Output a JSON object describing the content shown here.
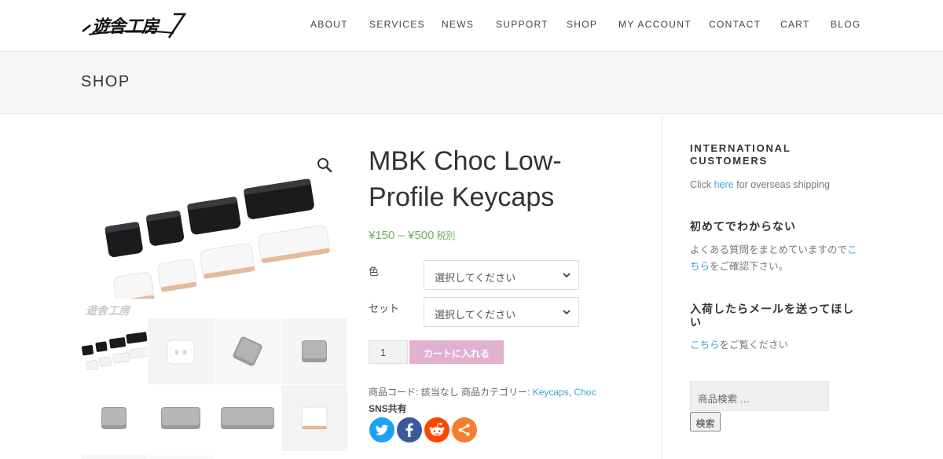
{
  "site": {
    "logo_text": "遊舎工房"
  },
  "nav": {
    "items": [
      {
        "label": "ABOUT"
      },
      {
        "label": "SERVICES"
      },
      {
        "label": "NEWS"
      },
      {
        "label": "SUPPORT"
      },
      {
        "label": "SHOP"
      },
      {
        "label": "MY ACCOUNT"
      },
      {
        "label": "CONTACT"
      },
      {
        "label": "CART"
      },
      {
        "label": "BLOG"
      }
    ]
  },
  "page": {
    "title": "SHOP"
  },
  "product": {
    "title": "MBK Choc Low-Profile Keycaps",
    "price": "¥150 – ¥500",
    "price_suffix": "税別",
    "variations": [
      {
        "label": "色",
        "placeholder": "選択してください"
      },
      {
        "label": "セット",
        "placeholder": "選択してください"
      }
    ],
    "quantity": "1",
    "add_to_cart_label": "カートに入れる",
    "meta": {
      "sku_label": "商品コード:",
      "sku_value": "該当なし",
      "category_label": "商品カテゴリー:",
      "categories": [
        "Keycaps",
        "Choc"
      ],
      "separator": ","
    },
    "share_label": "SNS共有",
    "share_buttons": [
      {
        "icon": "twitter-icon",
        "color": "#1da1f2"
      },
      {
        "icon": "facebook-icon",
        "color": "#3b5998"
      },
      {
        "icon": "reddit-icon",
        "color": "#ff4500"
      },
      {
        "icon": "share-icon",
        "color": "#f57d2c"
      }
    ]
  },
  "sidebar": {
    "international": {
      "title": "INTERNATIONAL CUSTOMERS",
      "text_before": "Click",
      "link": "here",
      "text_after": "for overseas shipping"
    },
    "first_time": {
      "title": "初めてでわからない",
      "text_before": "よくある質問をまとめていますので",
      "link": "こちら",
      "text_after": "をご確認下さい。"
    },
    "restock": {
      "title": "入荷したらメールを送ってほしい",
      "link": "こちら",
      "text_after": "をご覧ください"
    },
    "search": {
      "placeholder": "商品検索 …",
      "button_label": "検索"
    }
  },
  "colors": {
    "accent_link": "#3aa4d8",
    "price": "#6fae5a",
    "cart_button": "#e0b2ce"
  }
}
